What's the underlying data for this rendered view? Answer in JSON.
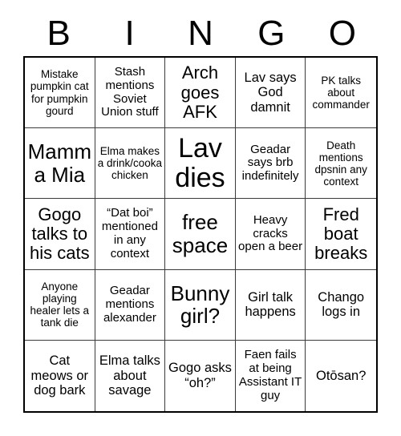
{
  "header": {
    "letters": [
      "B",
      "I",
      "N",
      "G",
      "O"
    ]
  },
  "grid": {
    "rows": 5,
    "columns": 5,
    "free_space_index": 12,
    "border_color": "#000000",
    "grid_line_color": "#3a3a3a",
    "background_color": "#ffffff",
    "text_color": "#000000",
    "cells": [
      {
        "text": "Mistake pumpkin cat for pumpkin gourd",
        "size": "t-xs"
      },
      {
        "text": "Stash mentions Soviet Union stuff",
        "size": "t-sm"
      },
      {
        "text": "Arch goes AFK",
        "size": "t-lg"
      },
      {
        "text": "Lav says God damnit",
        "size": "t-md"
      },
      {
        "text": "PK talks about commander",
        "size": "t-xs"
      },
      {
        "text": "Mamma Mia",
        "size": "t-xl"
      },
      {
        "text": "Elma makes a drink/cooka chicken",
        "size": "t-xs"
      },
      {
        "text": "Lav dies",
        "size": "t-xxl"
      },
      {
        "text": "Geadar says brb indefinitely",
        "size": "t-sm"
      },
      {
        "text": "Death mentions dpsnin any context",
        "size": "t-xs"
      },
      {
        "text": "Gogo talks to his cats",
        "size": "t-lg"
      },
      {
        "text": "“Dat boi” mentioned in any context",
        "size": "t-sm"
      },
      {
        "text": "free space",
        "size": "t-xl"
      },
      {
        "text": "Heavy cracks open a beer",
        "size": "t-sm"
      },
      {
        "text": "Fred boat breaks",
        "size": "t-lg"
      },
      {
        "text": "Anyone playing healer lets a tank die",
        "size": "t-xs"
      },
      {
        "text": "Geadar mentions alexander",
        "size": "t-sm"
      },
      {
        "text": "Bunny girl?",
        "size": "t-xl"
      },
      {
        "text": "Girl talk happens",
        "size": "t-md"
      },
      {
        "text": "Chango logs in",
        "size": "t-md"
      },
      {
        "text": "Cat meows or dog bark",
        "size": "t-md"
      },
      {
        "text": "Elma talks about savage",
        "size": "t-md"
      },
      {
        "text": "Gogo asks “oh?”",
        "size": "t-md"
      },
      {
        "text": "Faen fails at being Assistant IT guy",
        "size": "t-sm"
      },
      {
        "text": "Otōsan?",
        "size": "t-md"
      }
    ]
  }
}
